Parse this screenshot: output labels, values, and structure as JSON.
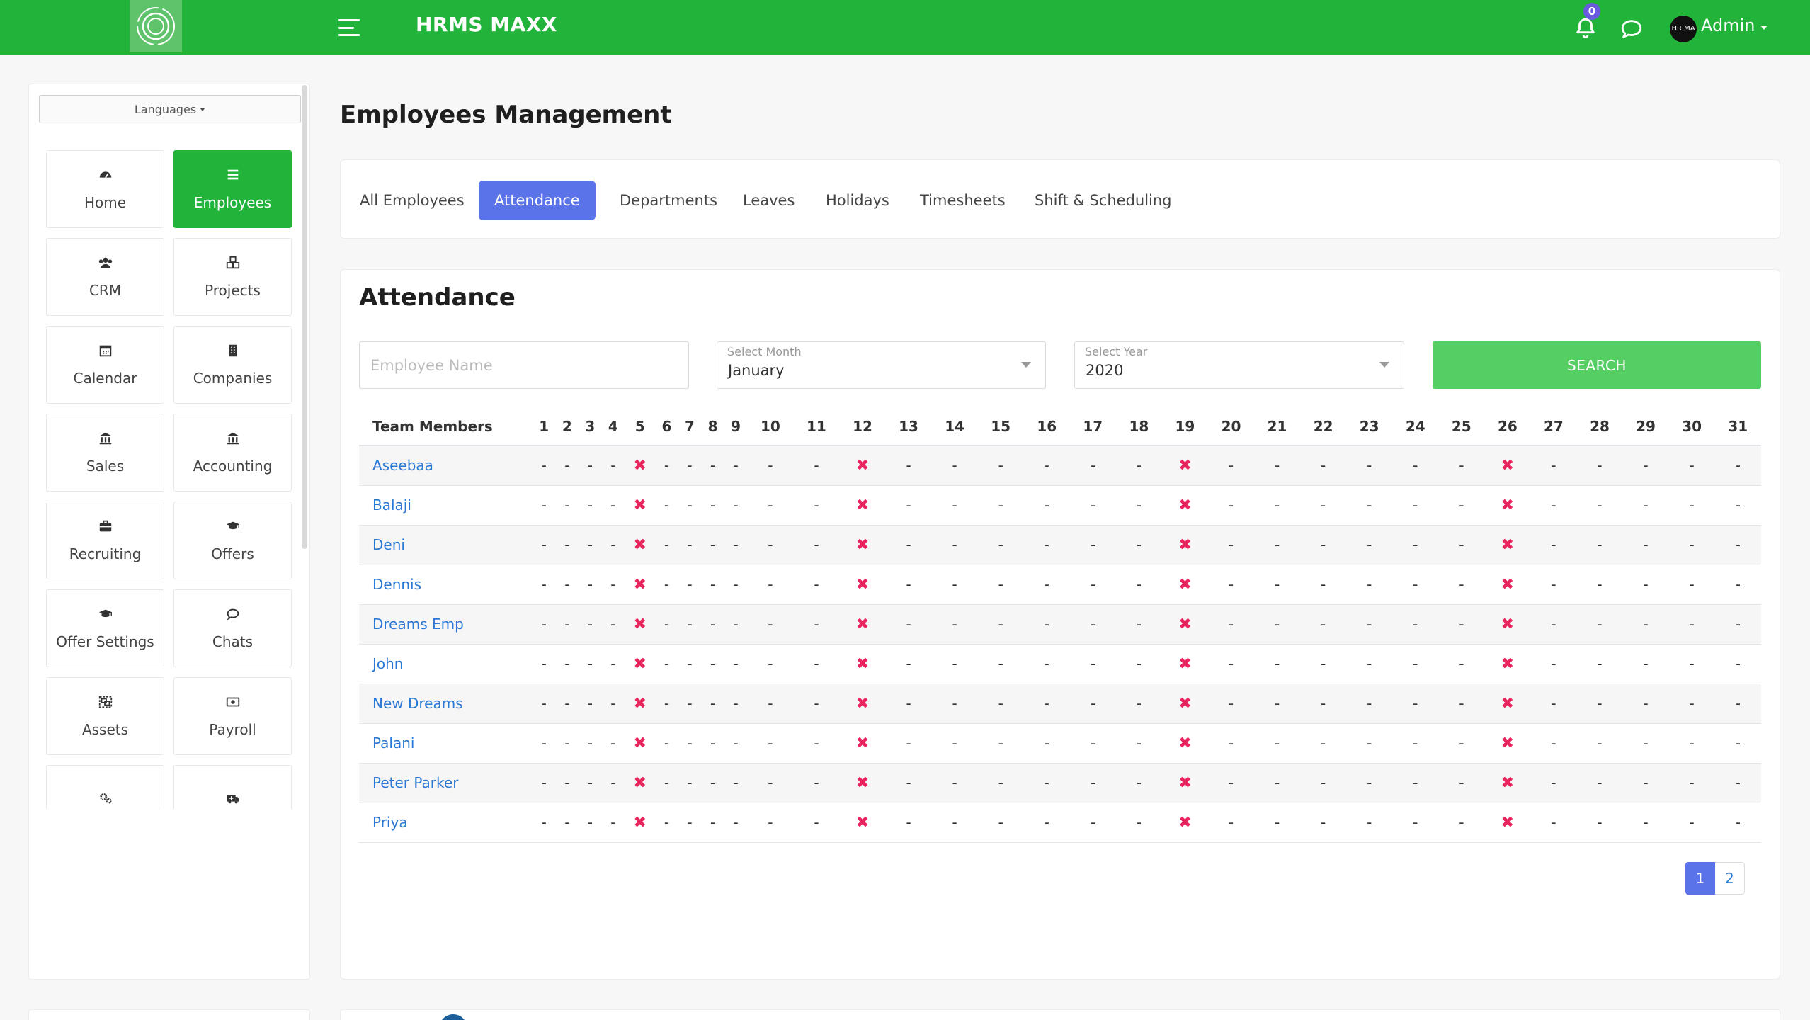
{
  "header": {
    "app_title": "HRMS MAXX",
    "notifications_count": "0",
    "user_name": "Admin",
    "avatar_text": "HR MA",
    "colors": {
      "bar": "#22b33b",
      "badge": "#6a5ae0"
    }
  },
  "sidebar": {
    "languages_label": "Languages",
    "items": [
      {
        "label": "Home",
        "icon": "dashboard-icon",
        "active": false
      },
      {
        "label": "Employees",
        "icon": "list-icon",
        "active": true
      },
      {
        "label": "CRM",
        "icon": "users-icon",
        "active": false
      },
      {
        "label": "Projects",
        "icon": "cubes-icon",
        "active": false
      },
      {
        "label": "Calendar",
        "icon": "calendar-icon",
        "active": false
      },
      {
        "label": "Companies",
        "icon": "building-icon",
        "active": false
      },
      {
        "label": "Sales",
        "icon": "bank-icon",
        "active": false
      },
      {
        "label": "Accounting",
        "icon": "bank-icon",
        "active": false
      },
      {
        "label": "Recruiting",
        "icon": "briefcase-icon",
        "active": false
      },
      {
        "label": "Offers",
        "icon": "graduation-cap-icon",
        "active": false
      },
      {
        "label": "Offer Settings",
        "icon": "graduation-cap-icon",
        "active": false
      },
      {
        "label": "Chats",
        "icon": "comment-icon",
        "active": false
      },
      {
        "label": "Assets",
        "icon": "object-group-icon",
        "active": false
      },
      {
        "label": "Payroll",
        "icon": "money-icon",
        "active": false
      },
      {
        "label": "",
        "icon": "cogs-icon",
        "active": false
      },
      {
        "label": "",
        "icon": "ambulance-icon",
        "active": false
      }
    ]
  },
  "page": {
    "title": "Employees Management",
    "tabs": [
      {
        "label": "All Employees",
        "active": false
      },
      {
        "label": "Attendance",
        "active": true
      },
      {
        "label": "Departments",
        "active": false
      },
      {
        "label": "Leaves",
        "active": false
      },
      {
        "label": "Holidays",
        "active": false
      },
      {
        "label": "Timesheets",
        "active": false
      },
      {
        "label": "Shift & Scheduling",
        "active": false
      }
    ]
  },
  "attendance": {
    "title": "Attendance",
    "employee_name_placeholder": "Employee Name",
    "month_label": "Select Month",
    "month_value": "January",
    "year_label": "Select Year",
    "year_value": "2020",
    "search_label": "SEARCH",
    "column_header": "Team Members",
    "days": [
      "1",
      "2",
      "3",
      "4",
      "5",
      "6",
      "7",
      "8",
      "9",
      "10",
      "11",
      "12",
      "13",
      "14",
      "15",
      "16",
      "17",
      "18",
      "19",
      "20",
      "21",
      "22",
      "23",
      "24",
      "25",
      "26",
      "27",
      "28",
      "29",
      "30",
      "31"
    ],
    "absent_days": [
      "5",
      "12",
      "19",
      "26"
    ],
    "default_mark": "-",
    "absent_mark": "✖",
    "members": [
      "Aseebaa",
      "Balaji",
      "Deni",
      "Dennis",
      "Dreams Emp",
      "John",
      "New Dreams",
      "Palani",
      "Peter Parker",
      "Priya"
    ],
    "pagination": {
      "pages": [
        "1",
        "2"
      ],
      "current": "1"
    },
    "colors": {
      "link": "#2a78d6",
      "absent": "#e8245f",
      "active_tab": "#5b73e8",
      "search": "#55ce63"
    }
  }
}
